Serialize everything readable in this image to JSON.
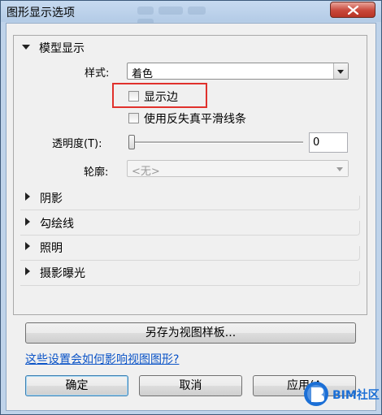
{
  "window": {
    "title": "图形显示选项"
  },
  "model_display": {
    "header": "模型显示",
    "style_label": "样式:",
    "style_value": "着色",
    "show_edges_label": "显示边",
    "antialias_label": "使用反失真平滑线条",
    "transparency_label": "透明度(T):",
    "transparency_value": "0",
    "transparency_level": 0,
    "silhouette_label": "轮廓:",
    "silhouette_value": "<无>"
  },
  "collapsed_sections": [
    {
      "label": "阴影"
    },
    {
      "label": "勾绘线"
    },
    {
      "label": "照明"
    },
    {
      "label": "摄影曝光"
    }
  ],
  "buttons": {
    "save_as_template": "另存为视图样板...",
    "ok": "确定",
    "cancel": "取消",
    "apply": "应用(A"
  },
  "help_link": "这些设置会如何影响视图图形?",
  "watermark": {
    "text": "BIM社区"
  },
  "colors": {
    "highlight": "#e0312c",
    "link": "#0a53c7",
    "close": "#c8473a"
  }
}
